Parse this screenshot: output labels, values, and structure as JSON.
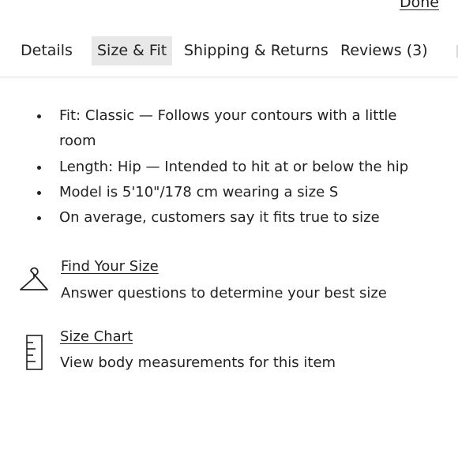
{
  "header": {
    "done_label": "Done"
  },
  "tabs": [
    {
      "label": "Details",
      "active": false
    },
    {
      "label": "Size & Fit",
      "active": true
    },
    {
      "label": "Shipping & Returns",
      "active": false
    },
    {
      "label": "Reviews (3)",
      "active": false
    }
  ],
  "fit_details": [
    "Fit: Classic — Follows your contours with a little room",
    "Length: Hip — Intended to hit at or below the hip",
    "Model is 5'10\"/178 cm wearing a size S",
    "On average, customers say it fits true to size"
  ],
  "find_your_size": {
    "icon": "hanger-icon",
    "title": "Find Your Size",
    "description": "Answer questions to determine your best size"
  },
  "size_chart": {
    "icon": "ruler-icon",
    "title": "Size Chart",
    "description": "View body measurements for this item"
  }
}
